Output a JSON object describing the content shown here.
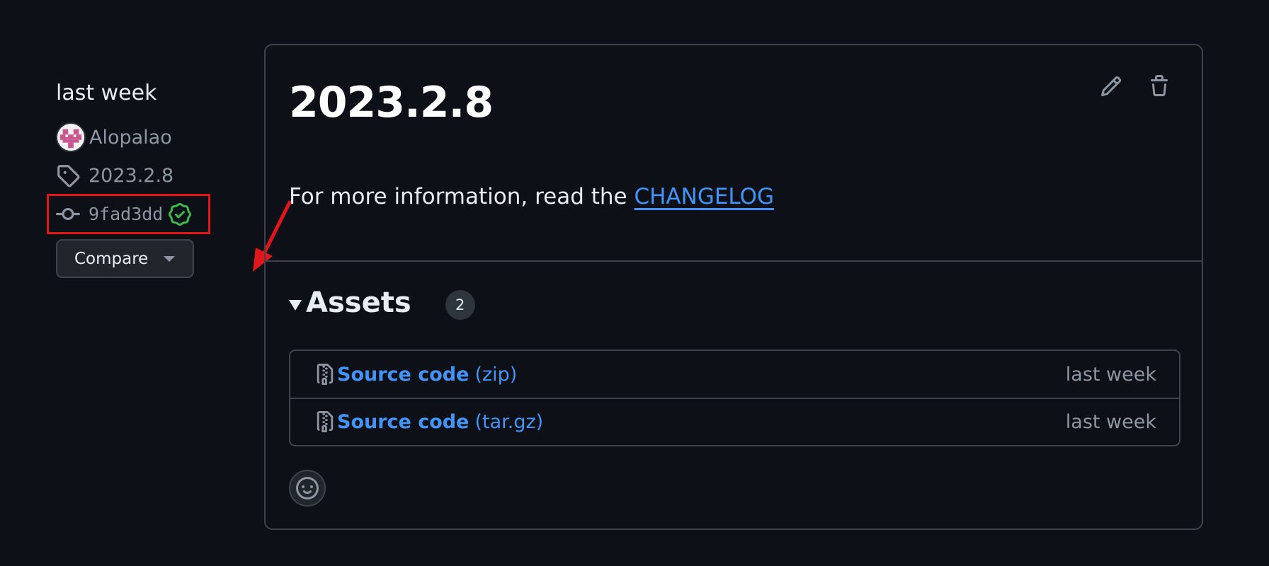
{
  "sidebar": {
    "date": "last week",
    "author": "Alopalao",
    "tag": "2023.2.8",
    "commit": "9fad3dd",
    "compare_label": "Compare"
  },
  "release": {
    "title": "2023.2.8",
    "body_prefix": "For more information, read the ",
    "body_link": "CHANGELOG"
  },
  "assets": {
    "title": "Assets",
    "count": "2",
    "items": [
      {
        "name": "Source code",
        "ext": "(zip)",
        "time": "last week"
      },
      {
        "name": "Source code",
        "ext": "(tar.gz)",
        "time": "last week"
      }
    ]
  },
  "colors": {
    "background": "#0d1117",
    "link": "#4493f8",
    "muted": "#8d96a0",
    "verified": "#3fb950",
    "annotation": "#e0161b"
  }
}
